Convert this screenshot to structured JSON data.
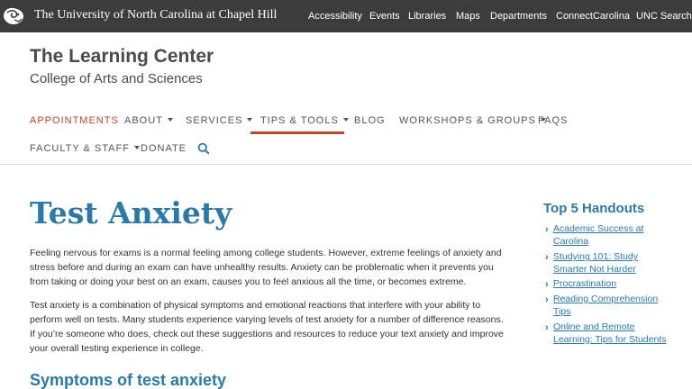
{
  "topbar": {
    "logo_icon": "unc-ram-logo-icon",
    "university_name": "The University of North Carolina at Chapel Hill",
    "links": [
      "Accessibility",
      "Events",
      "Libraries",
      "Maps",
      "Departments",
      "ConnectCarolina",
      "UNC Search"
    ]
  },
  "header": {
    "title": "The Learning Center",
    "subtitle": "College of Arts and Sciences"
  },
  "nav": {
    "items": [
      {
        "label": "APPOINTMENTS",
        "dropdown": false,
        "active": false
      },
      {
        "label": "ABOUT",
        "dropdown": true,
        "active": false
      },
      {
        "label": "SERVICES",
        "dropdown": true,
        "active": false
      },
      {
        "label": "TIPS & TOOLS",
        "dropdown": true,
        "active": true
      },
      {
        "label": "BLOG",
        "dropdown": false,
        "active": false
      },
      {
        "label": "WORKSHOPS & GROUPS",
        "dropdown": true,
        "active": false
      },
      {
        "label": "FAQS",
        "dropdown": false,
        "active": false
      },
      {
        "label": "FACULTY & STAFF",
        "dropdown": true,
        "active": false
      },
      {
        "label": "DONATE",
        "dropdown": false,
        "active": false
      }
    ],
    "search_icon": "search-icon"
  },
  "main": {
    "title": "Test Anxiety",
    "paragraphs": [
      "Feeling nervous for exams is a normal feeling among college students. However, extreme feelings of anxiety and stress before and during an exam can have unhealthy results. Anxiety can be problematic when it prevents you from taking or doing your best on an exam, causes you to feel anxious all the time, or becomes extreme.",
      "Test anxiety is a combination of physical symptoms and emotional reactions that interfere with your ability to perform well on tests. Many students experience varying levels of test anxiety for a number of difference reasons. If you’re someone who does, check out these suggestions and resources to reduce your text anxiety and improve your overall testing experience in college."
    ],
    "section_heading": "Symptoms of test anxiety"
  },
  "sidebar": {
    "title": "Top 5 Handouts",
    "handouts": [
      "Academic Success at Carolina",
      "Studying 101: Study Smarter Not Harder",
      "Procrastination",
      "Reading Comprehension Tips",
      "Online and Remote Learning: Tips for Students"
    ]
  },
  "colors": {
    "topbar_bg": "#3c3c3c",
    "accent_orange": "#c1462b",
    "link_blue": "#2a7aa8",
    "text": "#333333"
  }
}
